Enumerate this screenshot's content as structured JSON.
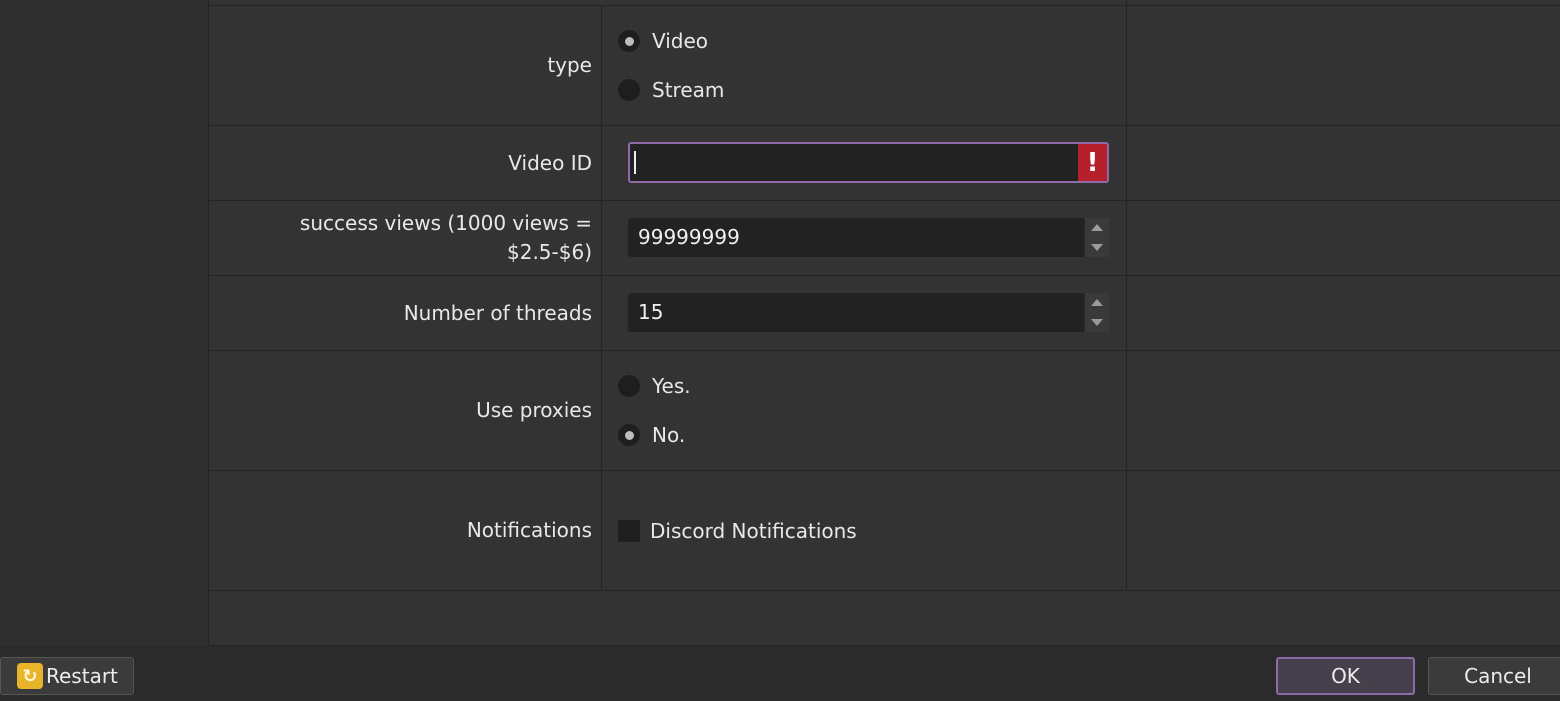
{
  "form": {
    "type": {
      "label": "type",
      "options": [
        "Video",
        "Stream"
      ],
      "selected": "Video"
    },
    "video_id": {
      "label": "Video ID",
      "value": "",
      "error_symbol": "!"
    },
    "success_views": {
      "label": "success views (1000 views = $2.5-$6)",
      "value": "99999999"
    },
    "threads": {
      "label": "Number of threads",
      "value": "15"
    },
    "use_proxies": {
      "label": "Use proxies",
      "options": [
        "Yes.",
        "No."
      ],
      "selected": "No."
    },
    "notifications": {
      "label": "Notifications",
      "checkbox_label": "Discord Notifications",
      "checked": false
    }
  },
  "footer": {
    "restart_label": "Restart",
    "ok_label": "OK",
    "cancel_label": "Cancel"
  },
  "colors": {
    "accent": "#8e6aa8",
    "error": "#b5202a",
    "restart_icon": "#e8b52a"
  },
  "icons": {
    "restart": "restart-icon",
    "error": "error-icon",
    "spin_up": "chevron-up-icon",
    "spin_down": "chevron-down-icon"
  }
}
